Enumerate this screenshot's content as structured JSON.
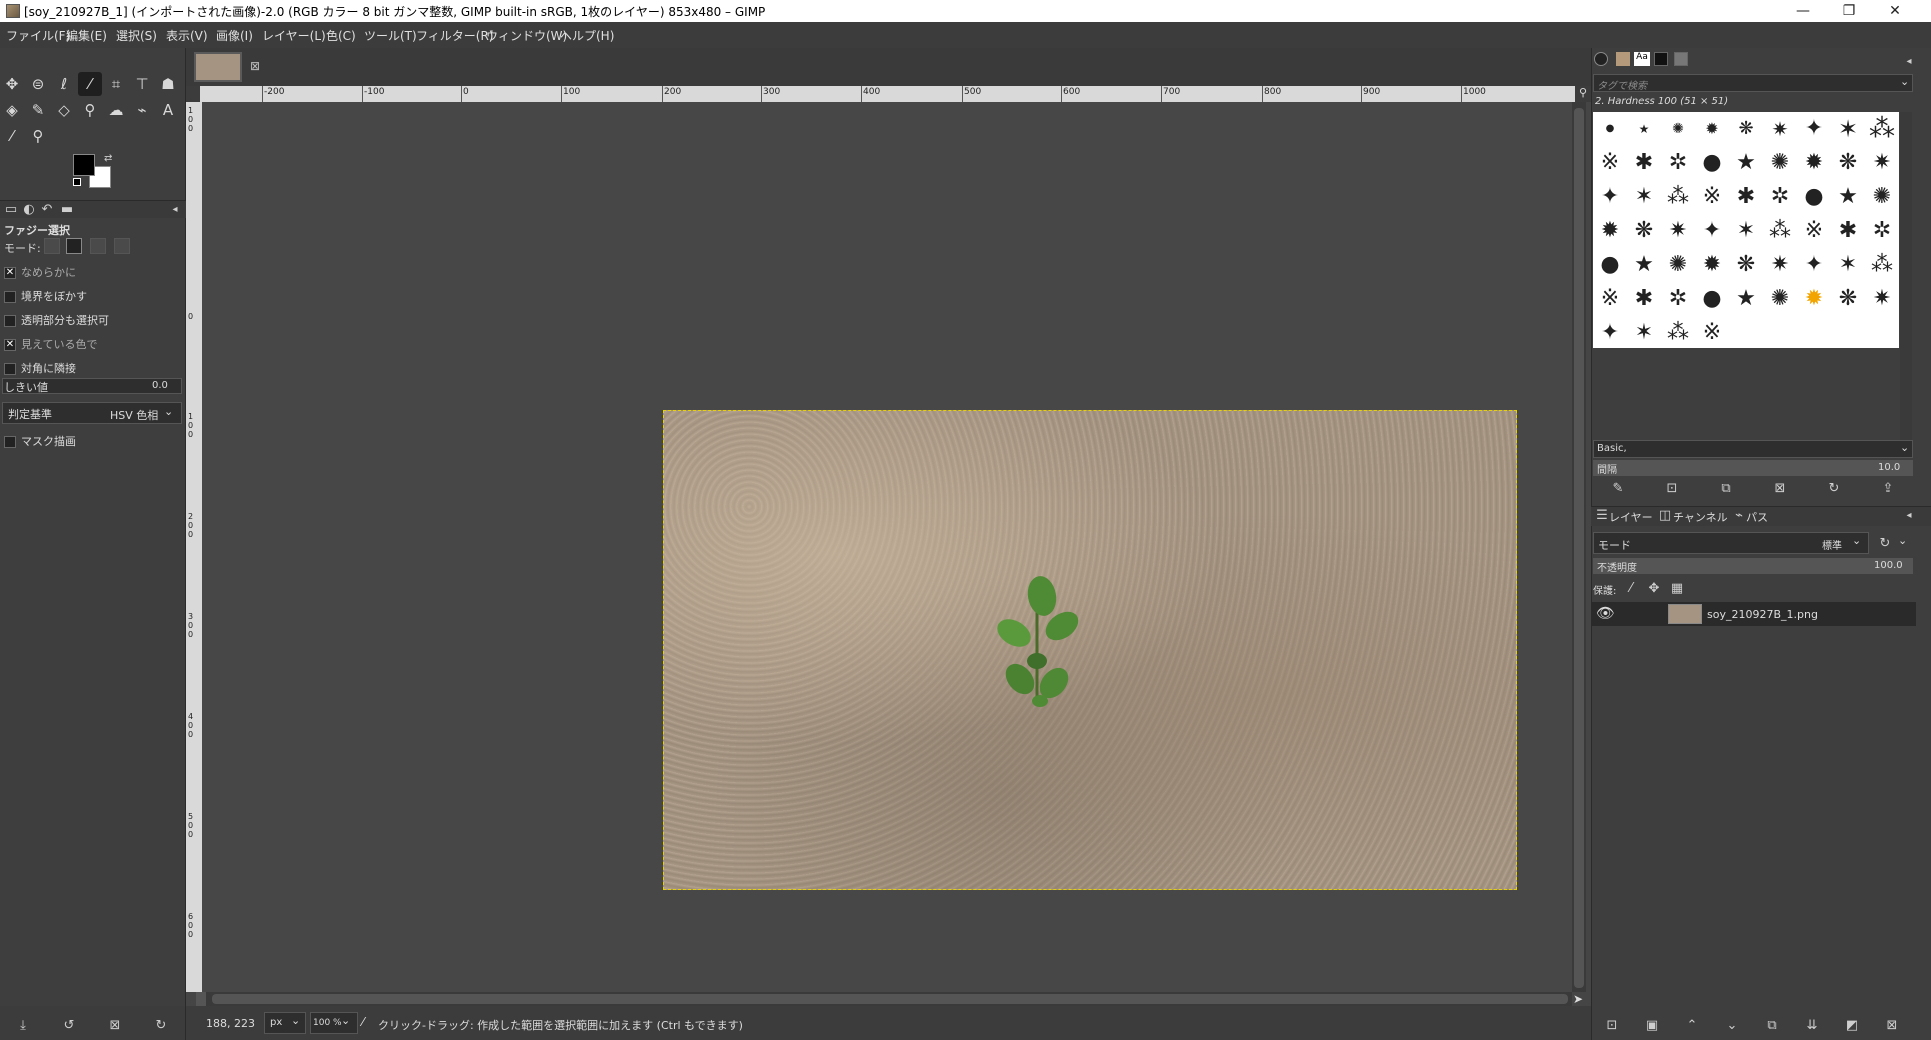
{
  "window": {
    "title": "[soy_210927B_1] (インポートされた画像)-2.0 (RGB カラー 8 bit ガンマ整数, GIMP built-in sRGB, 1枚のレイヤー) 853x480 – GIMP",
    "minimize": "—",
    "maximize": "❐",
    "close": "✕"
  },
  "menu": [
    "ファイル(F)",
    "編集(E)",
    "選択(S)",
    "表示(V)",
    "画像(I)",
    "レイヤー(L)",
    "色(C)",
    "ツール(T)",
    "フィルター(R)",
    "ウィンドウ(W)",
    "ヘルプ(H)"
  ],
  "tool_options": {
    "tool_name": "ファジー選択",
    "mode_label": "モード:",
    "antialias": "なめらかに",
    "feather": "境界をぼかす",
    "select_transparent": "透明部分も選択可",
    "sample_merged": "見えている色で",
    "diagonal": "対角に隣接",
    "threshold_label": "しきい値",
    "threshold_value": "0.0",
    "criterion_label": "判定基準",
    "criterion_value": "HSV 色相",
    "draw_mask": "マスク描画"
  },
  "rulers": {
    "horizontal": [
      "-200",
      "-100",
      "0",
      "100",
      "200",
      "300",
      "400",
      "500",
      "600",
      "700",
      "800",
      "900",
      "1000"
    ],
    "vertical": [
      "1\n0\n0",
      "0",
      "1\n0\n0",
      "2\n0\n0",
      "3\n0\n0",
      "4\n0\n0",
      "5\n0\n0",
      "6\n0\n0"
    ]
  },
  "status": {
    "coords": "188, 223",
    "unit": "px",
    "zoom": "100 %",
    "message": "クリック-ドラッグ: 作成した範囲を選択範囲に加えます (Ctrl もできます)"
  },
  "brushes": {
    "search_placeholder": "タグで検索",
    "selected_brush": "2. Hardness 100 (51 × 51)",
    "preset": "Basic,",
    "spacing_label": "間隔",
    "spacing_value": "10.0"
  },
  "layers": {
    "tabs": [
      "レイヤー",
      "チャンネル",
      "パス"
    ],
    "mode_label": "モード",
    "mode_value": "標準",
    "opacity_label": "不透明度",
    "opacity_value": "100.0",
    "lock_label": "保護:",
    "items": [
      {
        "name": "soy_210927B_1.png",
        "visible": true
      }
    ]
  }
}
